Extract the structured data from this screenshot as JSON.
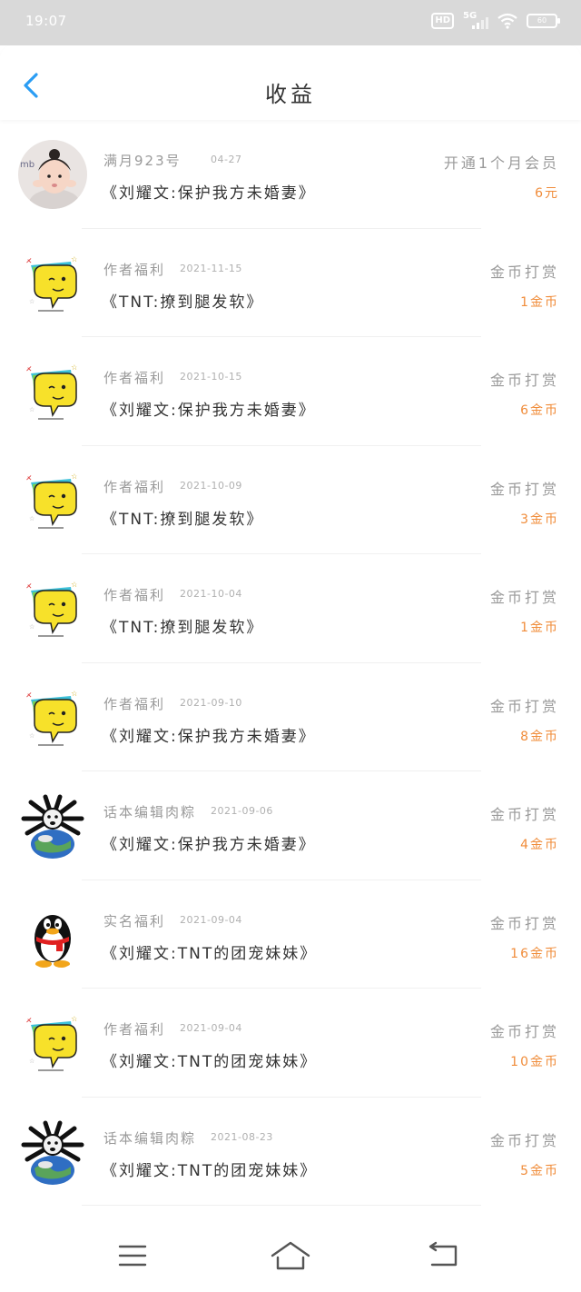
{
  "status_bar": {
    "time": "19:07",
    "hd": "HD",
    "network": "5G",
    "battery": "60"
  },
  "header": {
    "title": "收益"
  },
  "records": [
    {
      "avatar": "child-photo",
      "user": "满月923号",
      "date": "04-27",
      "title": "《刘耀文:保护我方未婚妻》",
      "type": "开通1个月会员",
      "amount": "6元"
    },
    {
      "avatar": "yellow-speech-bubble",
      "user": "作者福利",
      "date": "2021-11-15",
      "title": "《TNT:撩到腿发软》",
      "type": "金币打赏",
      "amount": "1金币"
    },
    {
      "avatar": "yellow-speech-bubble",
      "user": "作者福利",
      "date": "2021-10-15",
      "title": "《刘耀文:保护我方未婚妻》",
      "type": "金币打赏",
      "amount": "6金币"
    },
    {
      "avatar": "yellow-speech-bubble",
      "user": "作者福利",
      "date": "2021-10-09",
      "title": "《TNT:撩到腿发软》",
      "type": "金币打赏",
      "amount": "3金币"
    },
    {
      "avatar": "yellow-speech-bubble",
      "user": "作者福利",
      "date": "2021-10-04",
      "title": "《TNT:撩到腿发软》",
      "type": "金币打赏",
      "amount": "1金币"
    },
    {
      "avatar": "yellow-speech-bubble",
      "user": "作者福利",
      "date": "2021-09-10",
      "title": "《刘耀文:保护我方未婚妻》",
      "type": "金币打赏",
      "amount": "8金币"
    },
    {
      "avatar": "earth-spider-meme",
      "user": "话本编辑肉粽",
      "date": "2021-09-06",
      "title": "《刘耀文:保护我方未婚妻》",
      "type": "金币打赏",
      "amount": "4金币"
    },
    {
      "avatar": "qq-penguin",
      "user": "实名福利",
      "date": "2021-09-04",
      "title": "《刘耀文:TNT的团宠妹妹》",
      "type": "金币打赏",
      "amount": "16金币"
    },
    {
      "avatar": "yellow-speech-bubble",
      "user": "作者福利",
      "date": "2021-09-04",
      "title": "《刘耀文:TNT的团宠妹妹》",
      "type": "金币打赏",
      "amount": "10金币"
    },
    {
      "avatar": "earth-spider-meme",
      "user": "话本编辑肉粽",
      "date": "2021-08-23",
      "title": "《刘耀文:TNT的团宠妹妹》",
      "type": "金币打赏",
      "amount": "5金币"
    }
  ],
  "colors": {
    "accent_blue": "#2a9df4",
    "amount_orange": "#f08c3a",
    "status_bar_gray": "#d9d9d9"
  },
  "navbar": {
    "icons": [
      "menu-icon",
      "home-icon",
      "back-icon"
    ]
  }
}
